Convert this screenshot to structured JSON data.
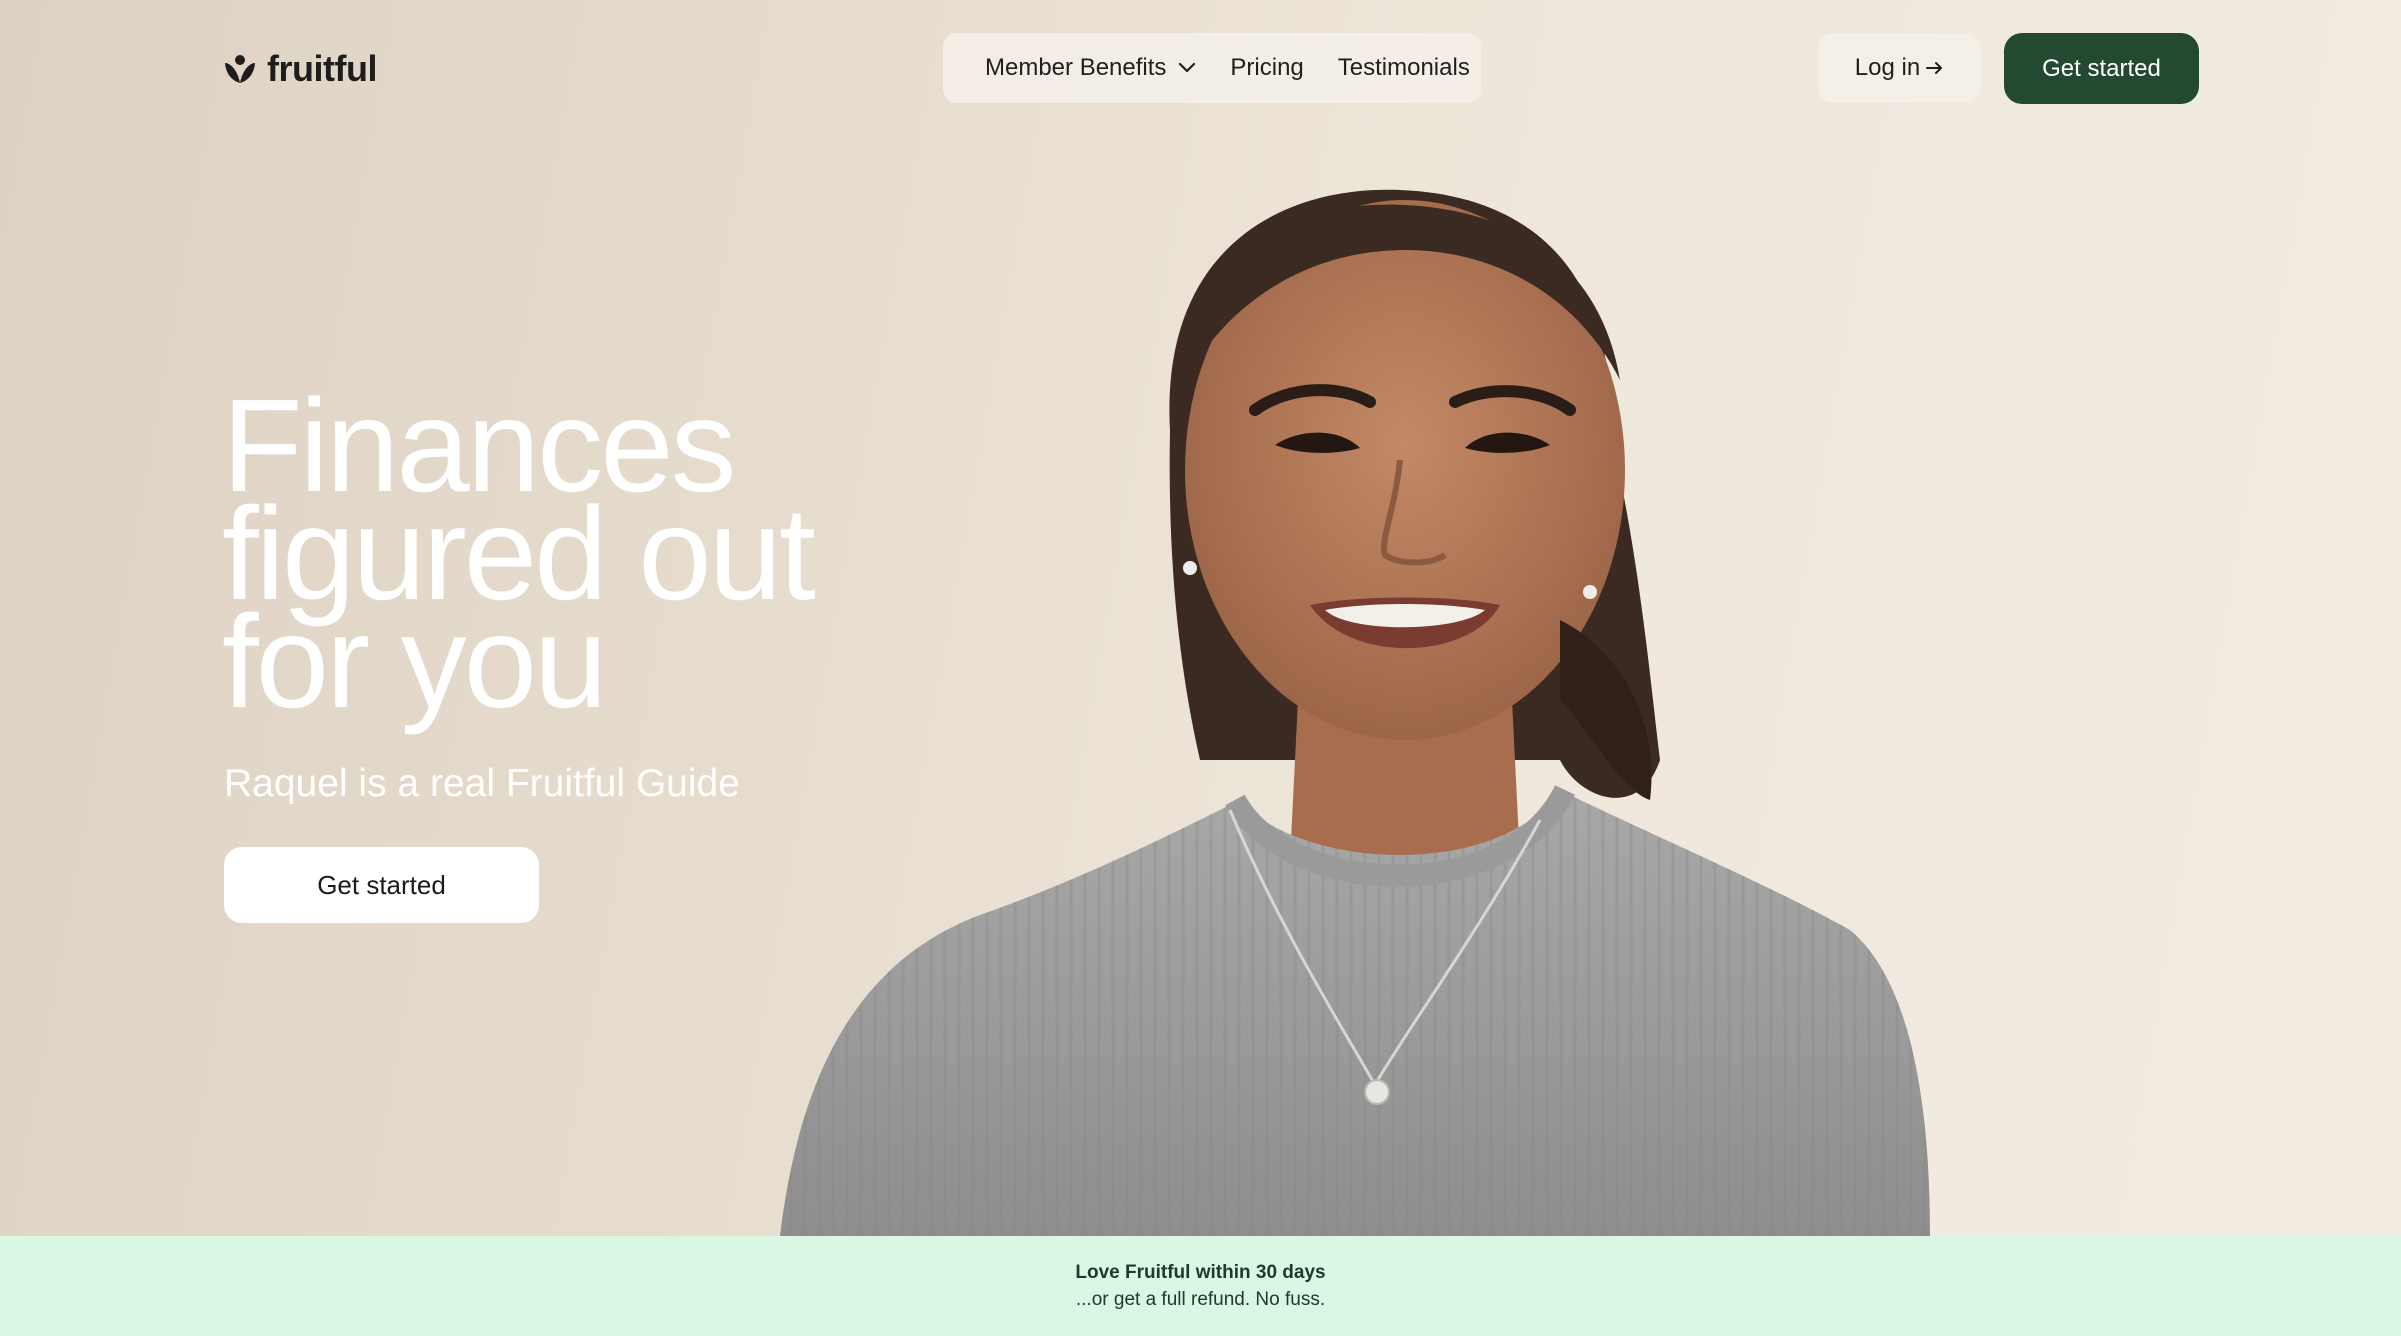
{
  "brand": {
    "name": "fruitful",
    "logo_icon": "fruitful-flower-icon"
  },
  "nav": {
    "items": [
      {
        "label": "Member Benefits",
        "icon": "chevron-down-icon"
      },
      {
        "label": "Pricing"
      },
      {
        "label": "Testimonials"
      }
    ],
    "login_label": "Log in",
    "login_icon": "arrow-right-icon",
    "cta_label": "Get started"
  },
  "hero": {
    "title_lines": [
      "Finances",
      "figured out",
      "for you"
    ],
    "subtitle": "Raquel is a real Fruitful Guide",
    "cta_label": "Get started"
  },
  "banner": {
    "title": "Love Fruitful within 30 days",
    "subtitle": "...or get a full refund. No fuss."
  },
  "colors": {
    "accent": "#234a30",
    "banner_bg": "#d9f7e2",
    "hero_bg": "#e9e0d3"
  }
}
